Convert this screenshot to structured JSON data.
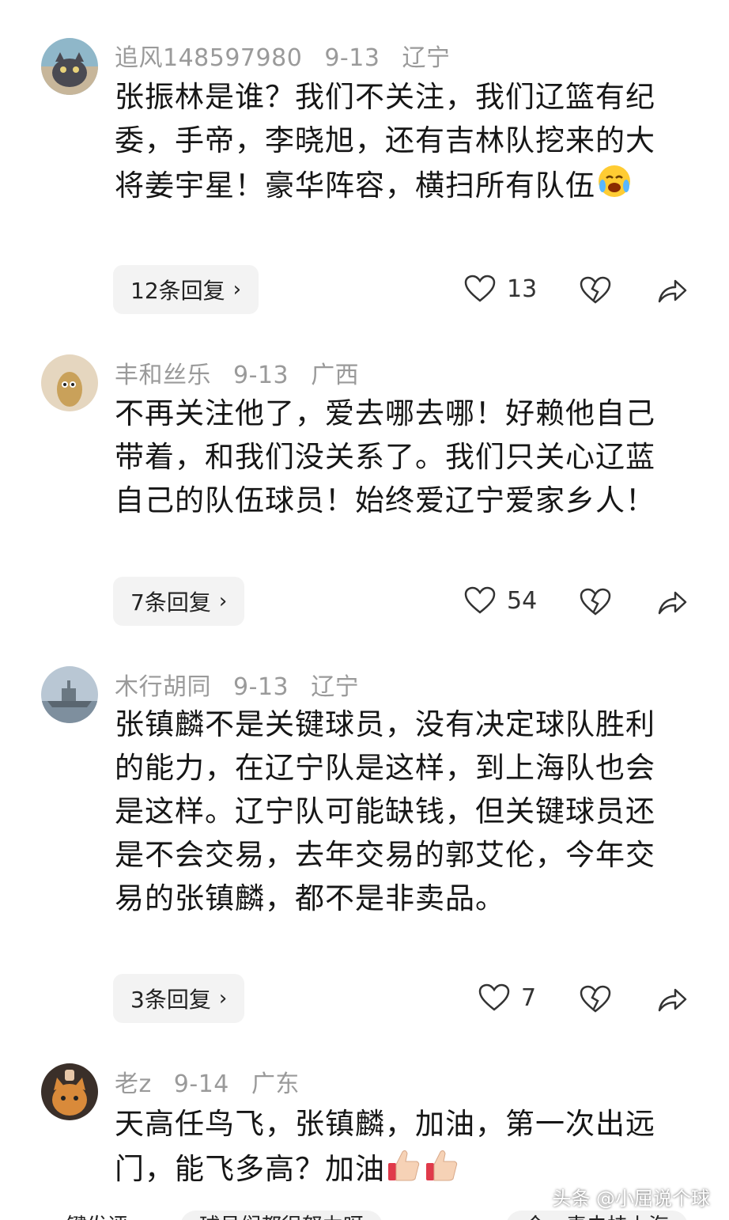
{
  "comments": [
    {
      "user": "追风148597980",
      "date": "9-13",
      "location": "辽宁",
      "text": "张振林是谁？我们不关注，我们辽篮有纪委，手帝，李晓旭，还有吉林队挖来的大将姜宇星！豪华阵容，横扫所有队伍",
      "emoji": "crying-laughing-face",
      "replies": "12条回复",
      "likes": "13",
      "avatar_icon": "cat-avatar"
    },
    {
      "user": "丰和丝乐",
      "date": "9-13",
      "location": "广西",
      "text": "不再关注他了，爱去哪去哪！好赖他自己带着，和我们没关系了。我们只关心辽蓝自己的队伍球员！始终爱辽宁爱家乡人！",
      "replies": "7条回复",
      "likes": "54",
      "avatar_icon": "cartoon-avatar"
    },
    {
      "user": "木行胡同",
      "date": "9-13",
      "location": "辽宁",
      "text": "张镇麟不是关键球员，没有决定球队胜利的能力，在辽宁队是这样，到上海队也会是这样。辽宁队可能缺钱，但关键球员还是不会交易，去年交易的郭艾伦，今年交易的张镇麟，都不是非卖品。",
      "replies": "3条回复",
      "likes": "7",
      "avatar_icon": "warship-avatar"
    },
    {
      "user": "老z",
      "date": "9-14",
      "location": "广东",
      "text": "天高任鸟飞，张镇麟，加油，第一次出远门，能飞多高？加油",
      "emoji": "thumbs-up x2",
      "avatar_icon": "kitten-avatar"
    }
  ],
  "bottom_chips": [
    "键发评",
    "球员们都很努力呀",
    "今，毒虫挂上海"
  ],
  "watermark": "头条 @小屈说个球",
  "colors": {
    "meta": "#9a9a9a",
    "text": "#161616",
    "reply_bg": "#f3f3f3"
  }
}
